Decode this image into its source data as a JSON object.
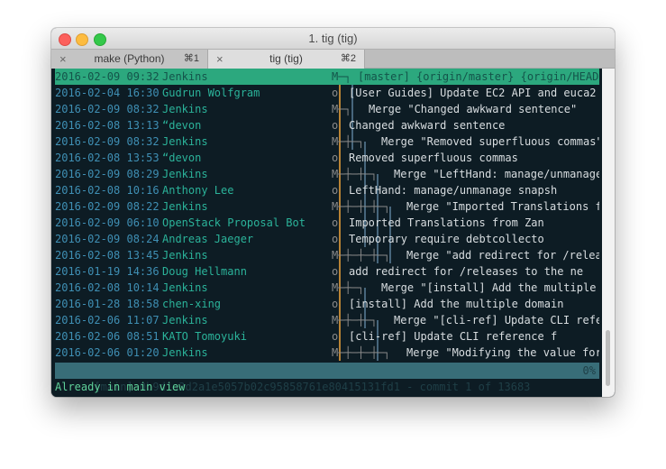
{
  "window": {
    "title": "1. tig (tig)",
    "tabs": [
      {
        "label": "make (Python)",
        "shortcut": "⌘1",
        "close": "×"
      },
      {
        "label": "tig (tig)",
        "shortcut": "⌘2",
        "close": "×"
      }
    ]
  },
  "commits": [
    {
      "date": "2016-02-09 09:32",
      "author": "Jenkins",
      "graph": "M─┐",
      "message": "[master] {origin/master} {origin/HEAD}",
      "selected": true
    },
    {
      "date": "2016-02-04 16:30",
      "author": "Gudrun Wolfgram",
      "graph": "o",
      "message": "[User Guides] Update EC2 API and euca2"
    },
    {
      "date": "2016-02-09 08:32",
      "author": "Jenkins",
      "graph": "M─┐",
      "message": "Merge \"Changed awkward sentence\""
    },
    {
      "date": "2016-02-08 13:13",
      "author": "“devon",
      "graph": "o",
      "message": "Changed awkward sentence"
    },
    {
      "date": "2016-02-09 08:32",
      "author": "Jenkins",
      "graph": "M─┼─┐",
      "message": "Merge \"Removed superfluous commas\""
    },
    {
      "date": "2016-02-08 13:53",
      "author": "“devon",
      "graph": "o",
      "message": "Removed superfluous commas"
    },
    {
      "date": "2016-02-09 08:29",
      "author": "Jenkins",
      "graph": "M─┼─┼─┐",
      "message": "Merge \"LeftHand: manage/unmanage"
    },
    {
      "date": "2016-02-08 10:16",
      "author": "Anthony Lee",
      "graph": "o",
      "message": "LeftHand: manage/unmanage snapsh"
    },
    {
      "date": "2016-02-09 08:22",
      "author": "Jenkins",
      "graph": "M─┼─┼─┼─┐",
      "message": "Merge \"Imported Translations f"
    },
    {
      "date": "2016-02-09 06:10",
      "author": "OpenStack Proposal Bot",
      "graph": "o",
      "message": "Imported Translations from Zan"
    },
    {
      "date": "2016-02-09 08:24",
      "author": "Andreas Jaeger",
      "graph": "o",
      "message": "Temporary require debtcollecto"
    },
    {
      "date": "2016-02-08 13:45",
      "author": "Jenkins",
      "graph": "M─┼─┼─┼─┐",
      "message": "Merge \"add redirect for /relea"
    },
    {
      "date": "2016-01-19 14:36",
      "author": "Doug Hellmann",
      "graph": "o",
      "message": "add redirect for /releases to the ne"
    },
    {
      "date": "2016-02-08 10:14",
      "author": "Jenkins",
      "graph": "M─┼─┐",
      "message": "Merge \"[install] Add the multiple"
    },
    {
      "date": "2016-01-28 18:58",
      "author": "chen-xing",
      "graph": "o",
      "message": "[install] Add the multiple domain"
    },
    {
      "date": "2016-02-06 11:07",
      "author": "Jenkins",
      "graph": "M─┼─┼─┐",
      "message": "Merge \"[cli-ref] Update CLI refe"
    },
    {
      "date": "2016-02-06 08:51",
      "author": "KATO Tomoyuki",
      "graph": "o",
      "message": "[cli-ref] Update CLI reference f"
    },
    {
      "date": "2016-02-06 01:20",
      "author": "Jenkins",
      "graph": "M─┼─┼─┼─┐",
      "message": "Merge \"Modifying the value for"
    }
  ],
  "status": {
    "text": "[main] 0b9d1a3d2a1e5057b02c95858761e80415131fd1 - commit 1 of 13683",
    "percent": "0%"
  },
  "prompt": "Already in main view",
  "colors": {
    "background": "#0d1c24",
    "selection": "#2ca87e",
    "date": "#3f8fb4",
    "author": "#2bb39a",
    "main_lane": "#f2a53c",
    "branch_lane": "#5b7f99",
    "status_bar": "#386d78",
    "prompt": "#5fd19a"
  },
  "icons": {
    "close": "x-icon",
    "traffic_lights": [
      "close-window-icon",
      "minimize-window-icon",
      "zoom-window-icon"
    ]
  }
}
